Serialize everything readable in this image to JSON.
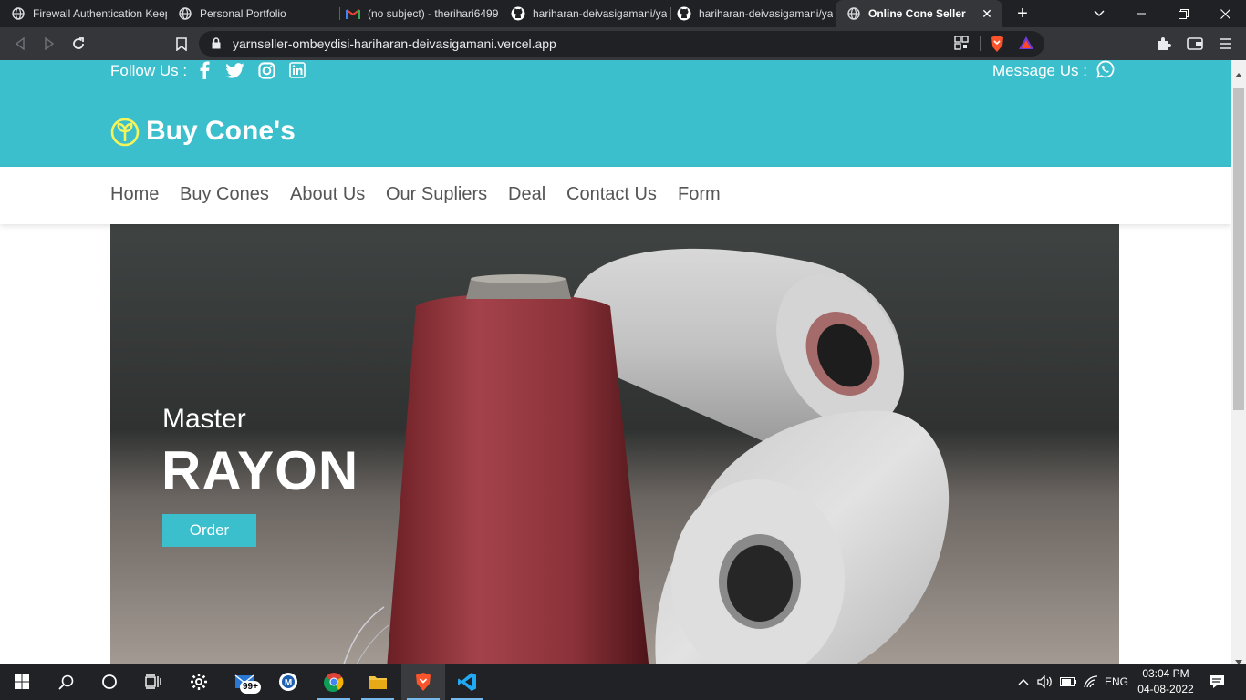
{
  "browser": {
    "tabs": [
      {
        "title": "Firewall Authentication Keep",
        "icon": "globe-icon",
        "active": false
      },
      {
        "title": "Personal Portfolio",
        "icon": "globe-icon",
        "active": false
      },
      {
        "title": "(no subject) - therihari6499",
        "icon": "gmail-icon",
        "active": false
      },
      {
        "title": "hariharan-deivasigamani/ya",
        "icon": "github-icon",
        "active": false
      },
      {
        "title": "hariharan-deivasigamani/ya",
        "icon": "github-icon",
        "active": false
      },
      {
        "title": "Online Cone Seller",
        "icon": "globe-icon",
        "active": true
      }
    ],
    "url": "yarnseller-ombeydisi-hariharan-deivasigamani.vercel.app"
  },
  "site": {
    "follow_label": "Follow Us :",
    "message_label": "Message Us :",
    "social": [
      "facebook-icon",
      "twitter-icon",
      "instagram-icon",
      "linkedin-icon"
    ],
    "brand": "Buy Cone's",
    "nav": [
      "Home",
      "Buy Cones",
      "About Us",
      "Our Supliers",
      "Deal",
      "Contact Us",
      "Form"
    ],
    "hero": {
      "subtitle": "Master",
      "title": "RAYON",
      "button": "Order"
    },
    "accent_color": "#3cbfcc"
  },
  "taskbar": {
    "mail_badge": "99+",
    "language": "ENG",
    "time": "03:04 PM",
    "date": "04-08-2022"
  }
}
